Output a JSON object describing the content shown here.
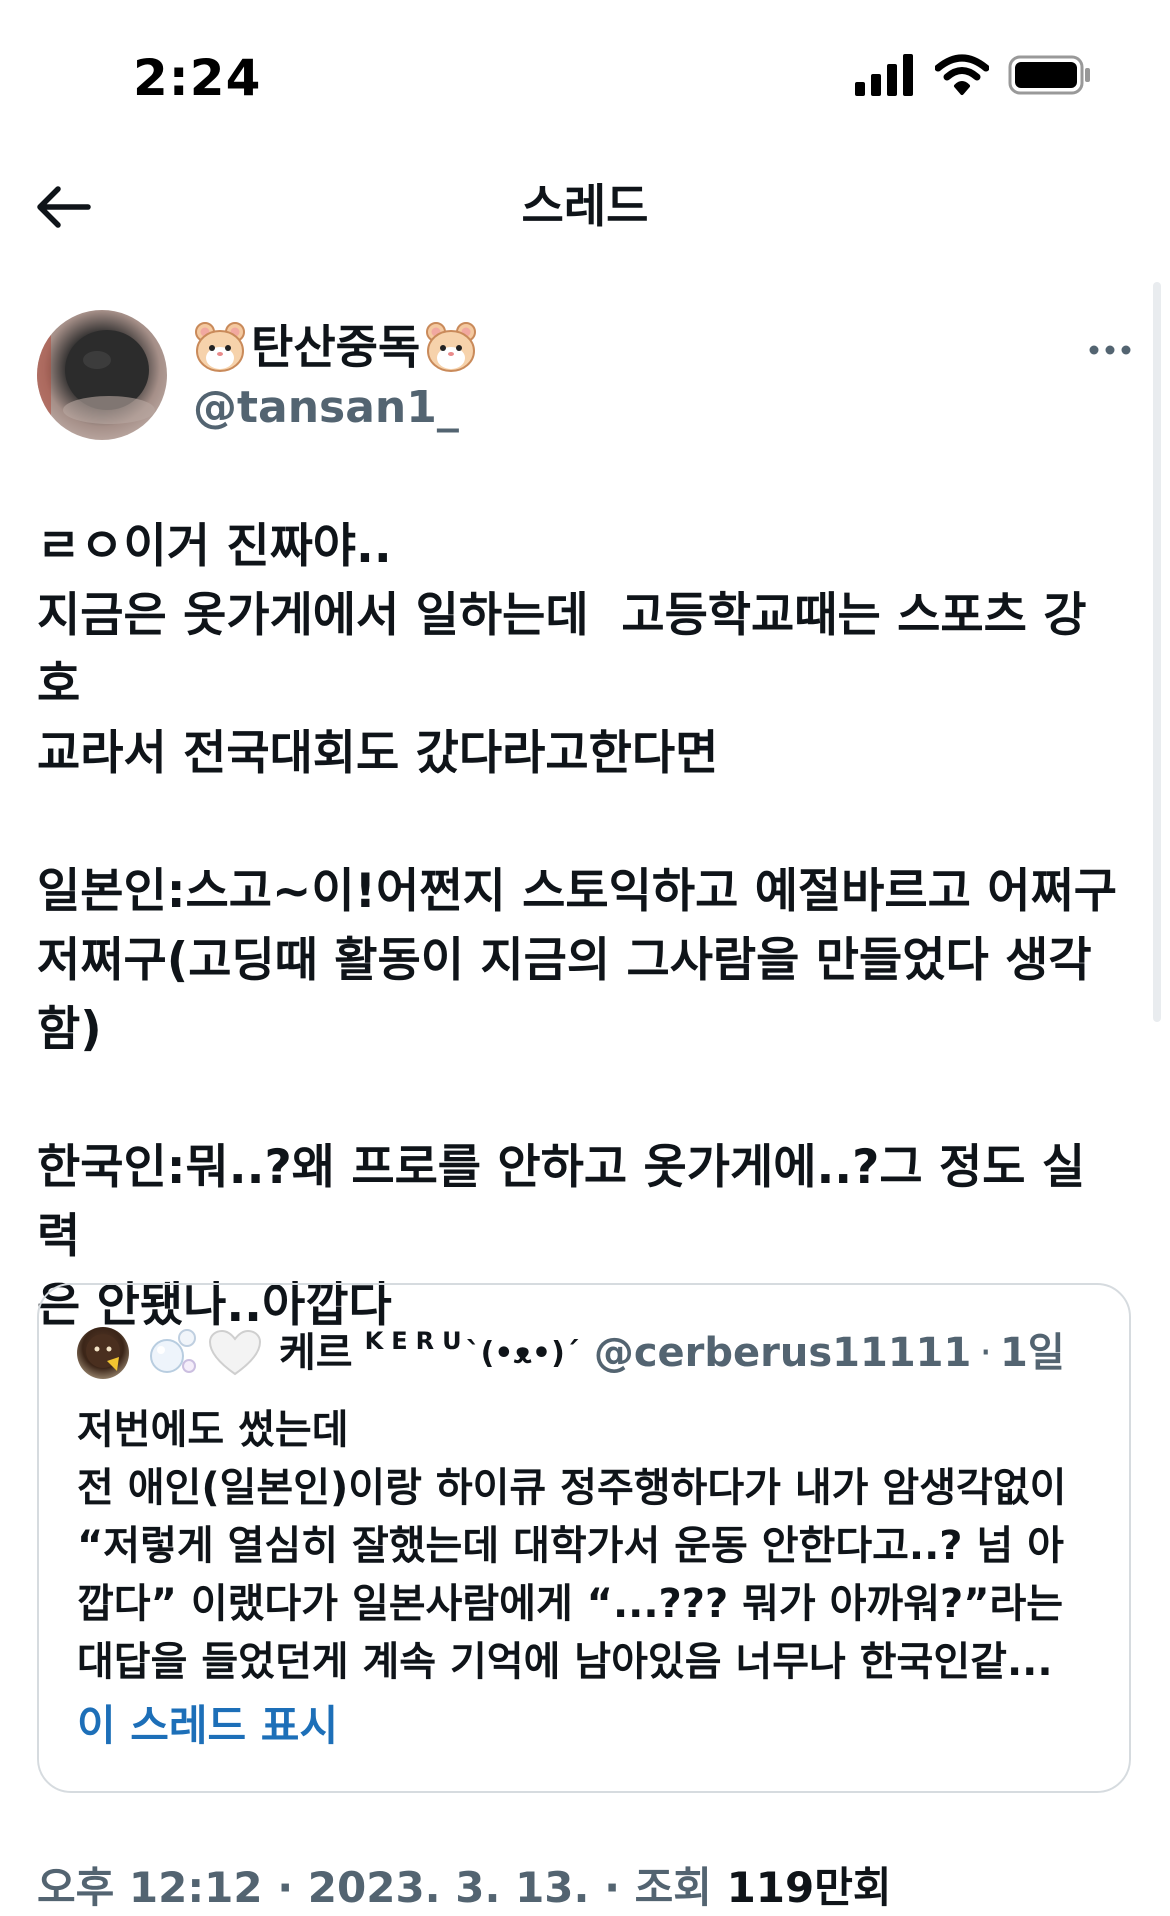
{
  "status_bar": {
    "time": "2:24",
    "signal_icon": "cellular-signal-icon",
    "wifi_icon": "wifi-icon",
    "battery_icon": "battery-full-icon"
  },
  "nav": {
    "back_icon": "arrow-left-icon",
    "title": "스레드"
  },
  "tweet": {
    "author_name": "탄산중독",
    "author_emoji": "hamster-icon",
    "author_handle": "@tansan1_",
    "more_icon": "more-horizontal-icon",
    "paragraphs": [
      [
        "ㄹㅇ이거 진짜야..",
        "지금은 옷가게에서 일하는데  고등학교때는 스포츠 강호",
        "교라서 전국대회도 갔다라고한다면"
      ],
      [
        "일본인:스고~이!어쩐지 스토익하고 예절바르고 어쩌구",
        "저쩌구(고딩때 활동이 지금의 그사람을 만들었다 생각",
        "함)"
      ],
      [
        "한국인:뭐..?왜 프로를 안하고 옷가게에..?그 정도 실력",
        "은 안됐나..아깝다"
      ]
    ]
  },
  "quote": {
    "name": "케르",
    "name_small": "KERU",
    "kaomoji": "ˋ(•ᴥ•)ˊ",
    "handle": "@cerberus11111",
    "separator": "·",
    "time": "1일",
    "lines": [
      "저번에도 썼는데",
      "전 애인(일본인)이랑 하이큐 정주행하다가 내가 암생각없이",
      "“저렇게 열심히 잘했는데 대학가서 운동 안한다고..? 넘 아",
      "깝다” 이랬다가 일본사람에게 “...??? 뭐가 아까워?”라는",
      "대답을 들었던게 계속 기억에 남아있음 너무나 한국인같..."
    ],
    "show_thread": "이 스레드 표시"
  },
  "meta": {
    "time_prefix": "오후 12:12 · 2023. 3. 13. · 조회 ",
    "views": "119",
    "views_suffix": "만회"
  },
  "colors": {
    "text_primary": "#0f1419",
    "text_secondary": "#536471",
    "link": "#1d6fb8",
    "border": "#d6dbdf"
  }
}
